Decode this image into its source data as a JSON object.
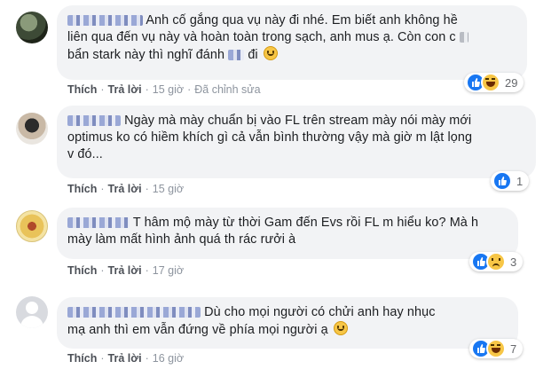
{
  "comments": [
    {
      "text_lines": [
        "Anh cố gắng qua vụ này đi nhé. Em biết anh không hề",
        "liên qua đến vụ này và hoàn toàn trong sạch, anh mus ạ. Còn con c",
        "bẩn stark này thì nghĩ đánh",
        "đi"
      ],
      "actions": {
        "like": "Thích",
        "reply": "Trả lời",
        "time": "15 giờ",
        "edited": "Đã chỉnh sửa"
      },
      "reactions": {
        "icons": [
          "like-icon",
          "haha-icon"
        ],
        "count": "29"
      }
    },
    {
      "text_lines": [
        "Ngày mà mày chuẩn bị vào FL trên stream mày nói mày mới",
        "optimus ko có hiềm khích gì cả vẫn bình thường vậy mà giờ m lật lọng",
        "v đó..."
      ],
      "actions": {
        "like": "Thích",
        "reply": "Trả lời",
        "time": "15 giờ"
      },
      "reactions": {
        "icons": [
          "like-icon"
        ],
        "count": "1"
      }
    },
    {
      "text_lines": [
        "T hâm mộ mày từ thời Gam đến Evs rồi FL m hiểu ko? Mà h",
        "mày làm mất hình ảnh quá th rác rưởi à"
      ],
      "actions": {
        "like": "Thích",
        "reply": "Trả lời",
        "time": "17 giờ"
      },
      "reactions": {
        "icons": [
          "like-icon",
          "sad-icon"
        ],
        "count": "3"
      }
    },
    {
      "text_lines": [
        "Dù cho mọi người có chửi anh hay nhục",
        "mạ anh thì em vẫn đứng về phía mọi người ạ"
      ],
      "actions": {
        "like": "Thích",
        "reply": "Trả lời",
        "time": "16 giờ"
      },
      "reactions": {
        "icons": [
          "like-icon",
          "haha-icon"
        ],
        "count": "7"
      }
    }
  ],
  "colors": {
    "bubble": "#f2f3f5",
    "like": "#1877f2",
    "action_text": "#8d949e",
    "body_text": "#1c1e21"
  }
}
